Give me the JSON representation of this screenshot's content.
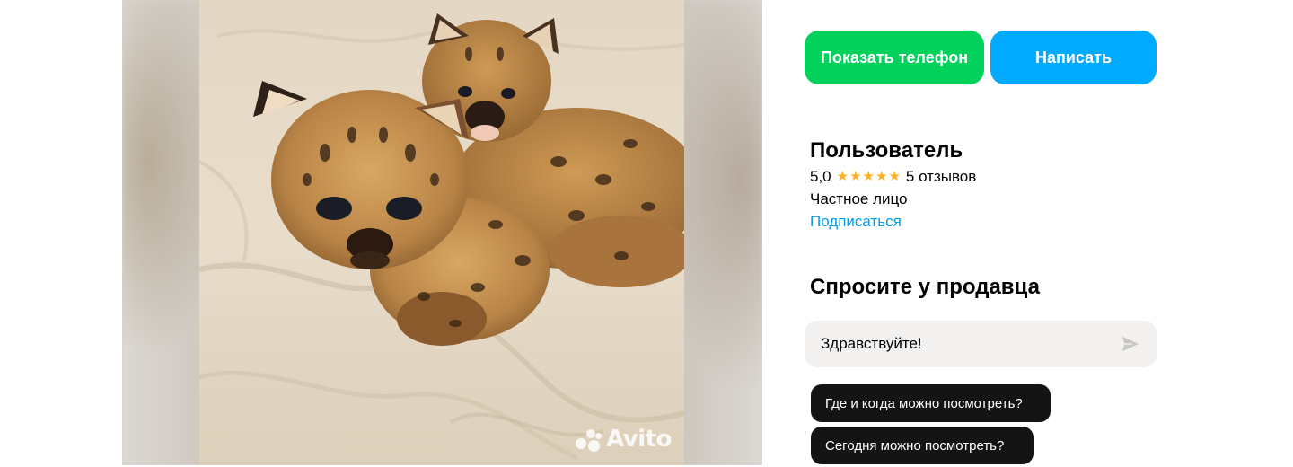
{
  "gallery": {
    "image_alt": "Two serval kittens lying on a beige blanket",
    "watermark": "Avito"
  },
  "actions": {
    "show_phone_label": "Показать телефон",
    "write_label": "Написать",
    "phone_color": "#02d15c",
    "write_color": "#00aaff"
  },
  "seller": {
    "name": "Пользователь",
    "rating": "5,0",
    "stars": 5,
    "reviews": "5 отзывов",
    "type": "Частное лицо",
    "subscribe_label": "Подписаться"
  },
  "ask": {
    "title": "Спросите у продавца",
    "message": "Здравствуйте!",
    "suggestions": [
      "Где и когда можно посмотреть?",
      "Сегодня можно посмотреть?"
    ]
  },
  "icons": {
    "send": "send-icon",
    "star": "star-icon"
  }
}
